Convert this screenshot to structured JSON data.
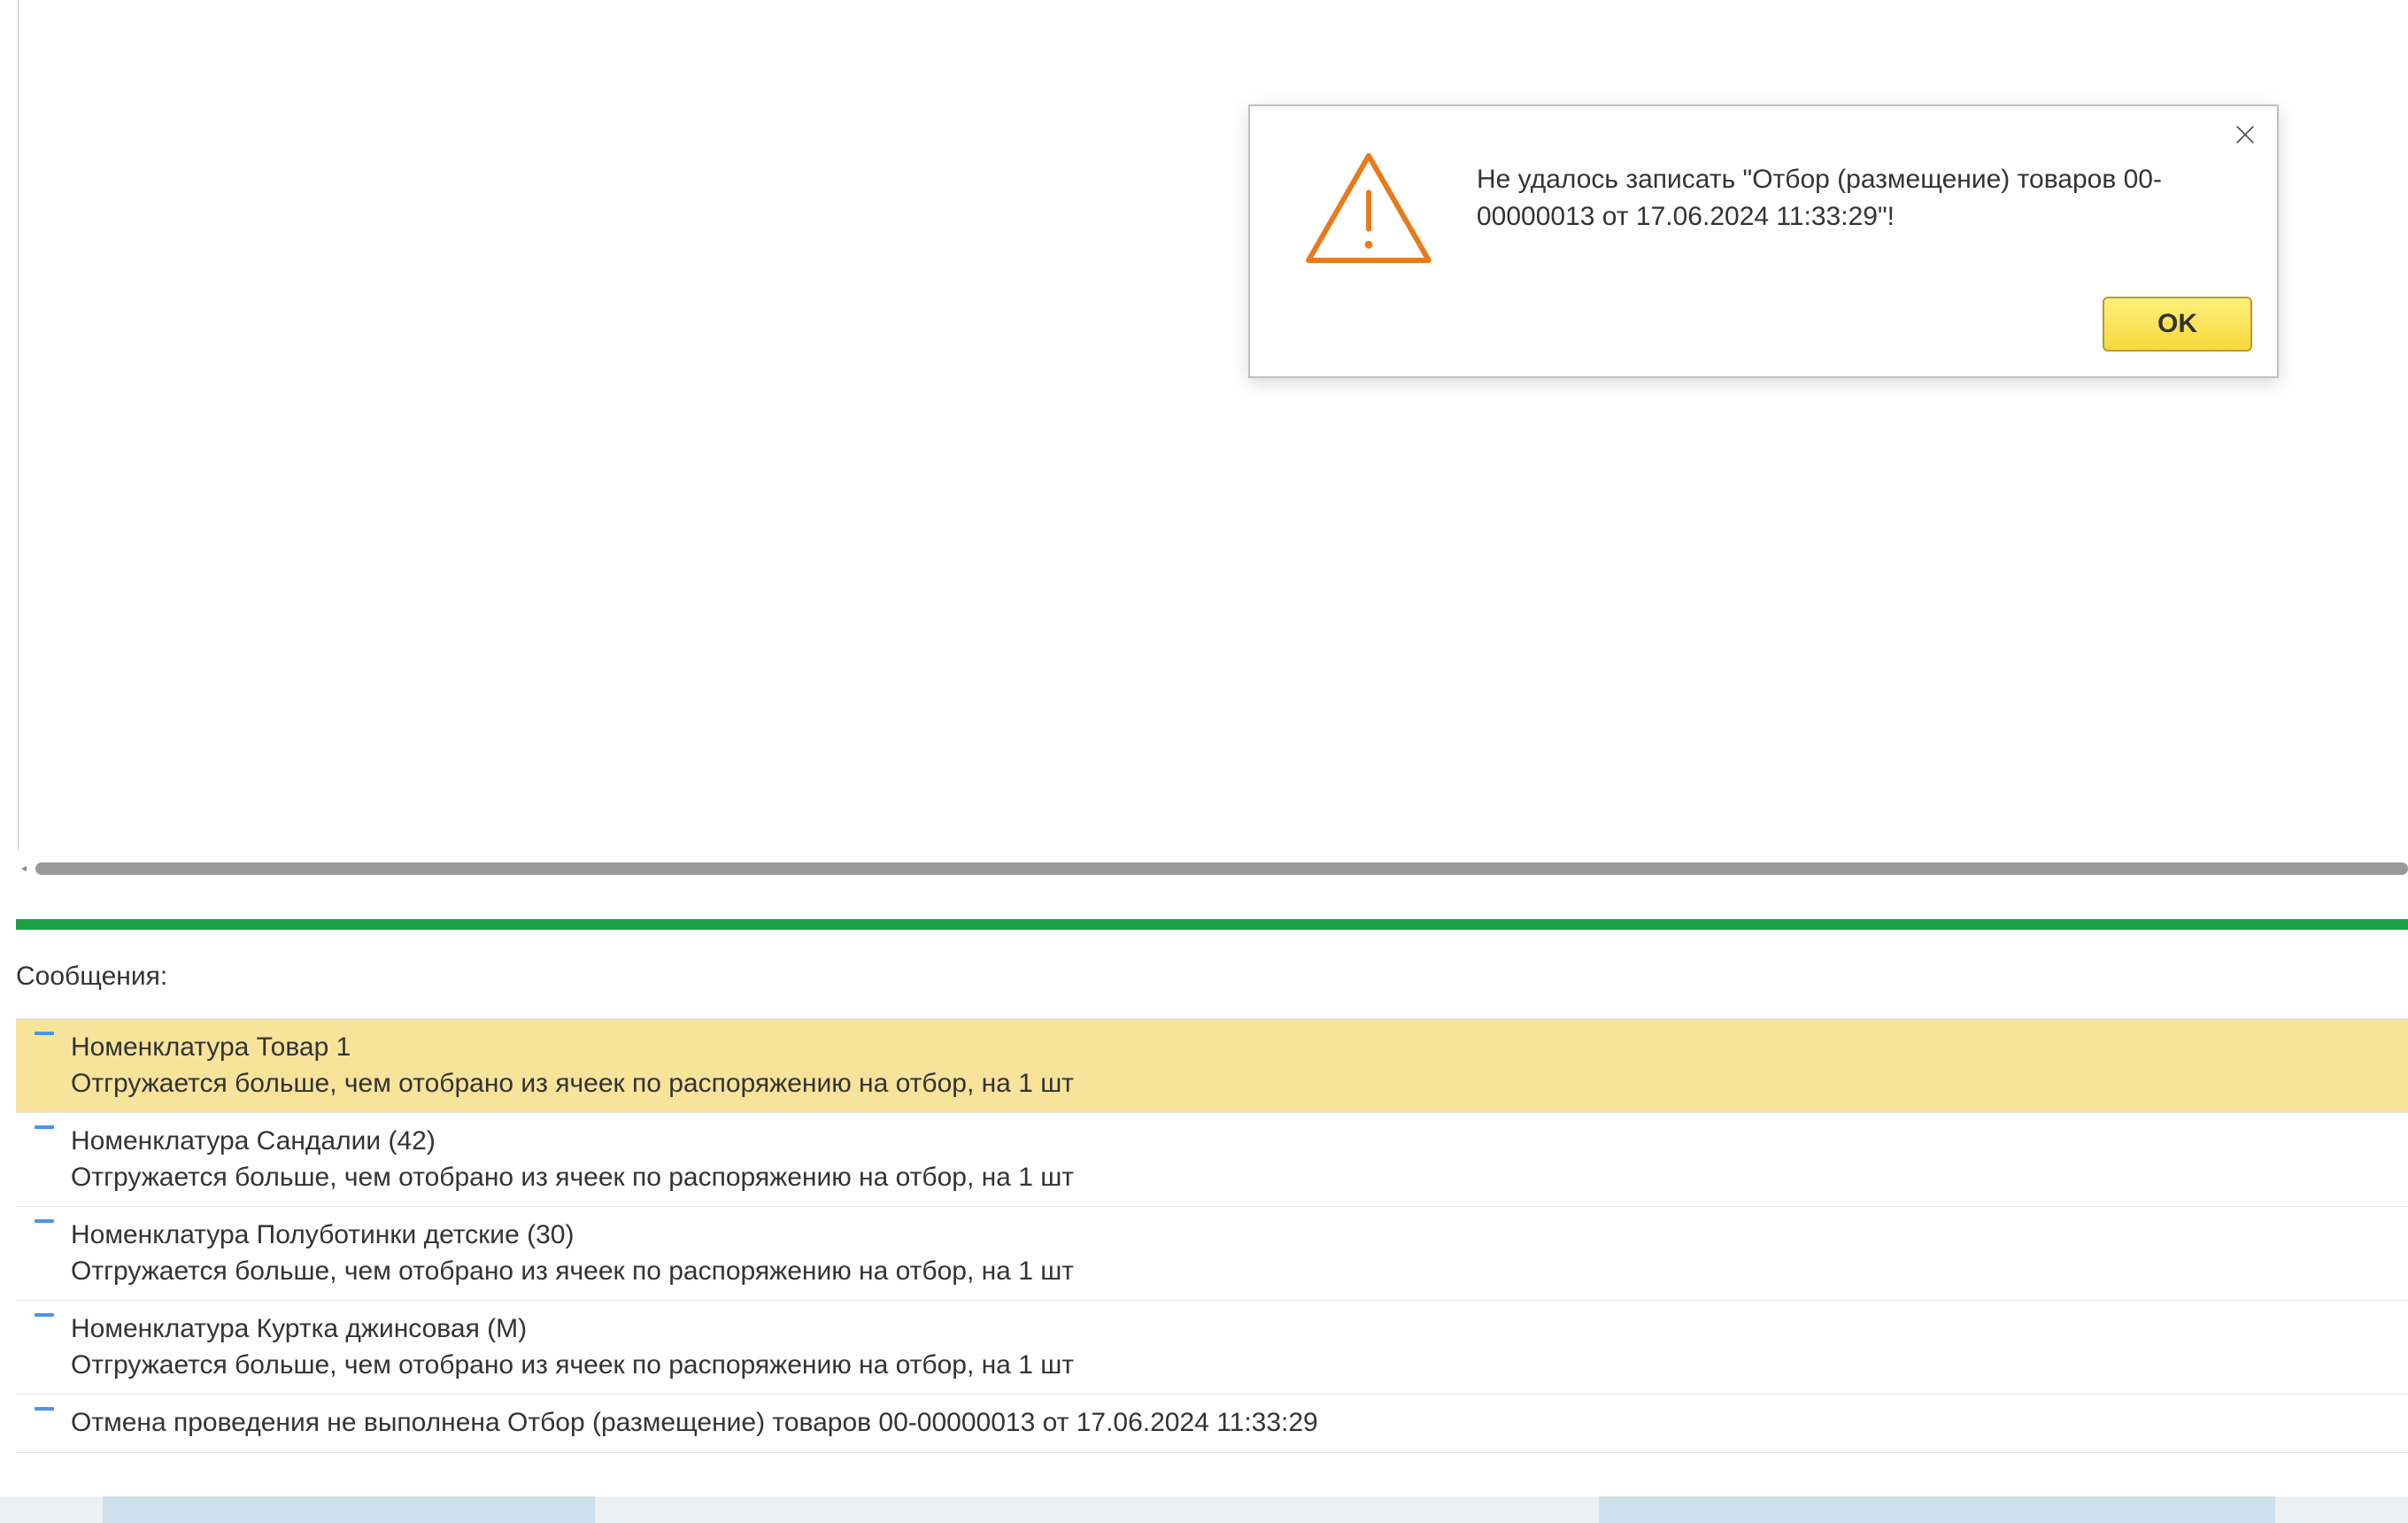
{
  "dialog": {
    "message": "Не удалось записать \"Отбор (размещение) товаров 00-00000013 от 17.06.2024 11:33:29\"!",
    "ok_label": "OK"
  },
  "messages_panel": {
    "title": "Сообщения:"
  },
  "messages": [
    {
      "line1": "Номенклатура Товар 1",
      "line2": "Отгружается больше, чем отобрано из ячеек по распоряжению на отбор, на 1 шт",
      "selected": true
    },
    {
      "line1": "Номенклатура Сандалии (42)",
      "line2": "Отгружается больше, чем отобрано из ячеек по распоряжению на отбор, на 1 шт",
      "selected": false
    },
    {
      "line1": "Номенклатура Полуботинки детские (30)",
      "line2": "Отгружается больше, чем отобрано из ячеек по распоряжению на отбор, на 1 шт",
      "selected": false
    },
    {
      "line1": "Номенклатура Куртка джинсовая (M)",
      "line2": "Отгружается больше, чем отобрано из ячеек по распоряжению на отбор, на 1 шт",
      "selected": false
    },
    {
      "line1": "Отмена проведения не выполнена Отбор (размещение) товаров 00-00000013 от 17.06.2024 11:33:29",
      "line2": "",
      "selected": false
    }
  ]
}
